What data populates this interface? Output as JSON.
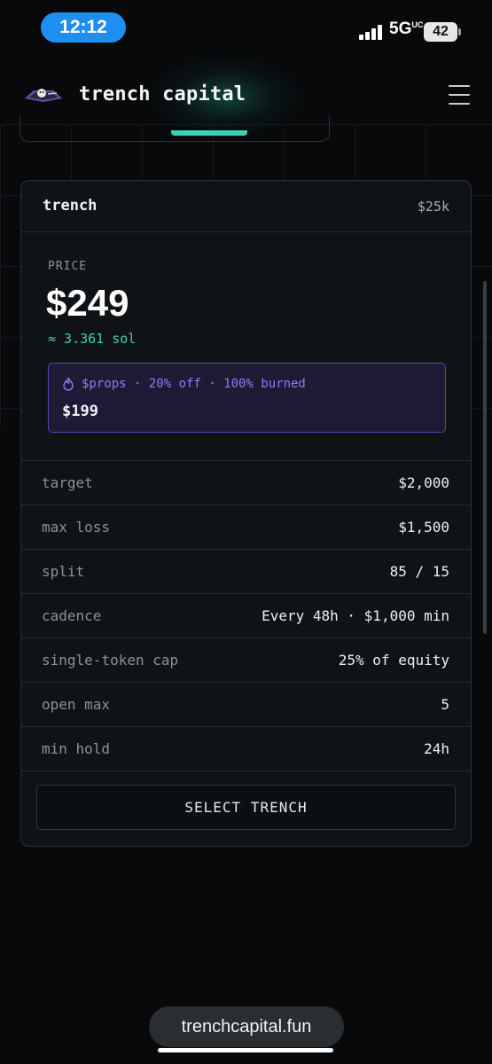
{
  "status_bar": {
    "time": "12:12",
    "network": "5G",
    "network_suffix": "UC",
    "battery": "42"
  },
  "header": {
    "title": "trench capital",
    "logo_icon": "trench-logo-icon",
    "menu_icon": "hamburger-menu-icon"
  },
  "card": {
    "name": "trench",
    "size": "$25k",
    "price_caption": "PRICE",
    "price": "$249",
    "price_sol": "≈ 3.361 sol",
    "promo": {
      "icon": "flame-icon",
      "text": "$props · 20% off · 100% burned",
      "price": "$199"
    },
    "rows": [
      {
        "label": "target",
        "value": "$2,000"
      },
      {
        "label": "max loss",
        "value": "$1,500"
      },
      {
        "label": "split",
        "value": "85 / 15"
      },
      {
        "label": "cadence",
        "value": "Every 48h · $1,000 min"
      },
      {
        "label": "single-token cap",
        "value": "25% of equity"
      },
      {
        "label": "open max",
        "value": "5"
      },
      {
        "label": "min hold",
        "value": "24h"
      }
    ],
    "select_label": "SELECT TRENCH"
  },
  "browser": {
    "url": "trenchcapital.fun"
  },
  "colors": {
    "accent": "#3fd1b7",
    "promo_text": "#8e7df0",
    "promo_bg": "#1d1a36",
    "background": "#07090b"
  }
}
